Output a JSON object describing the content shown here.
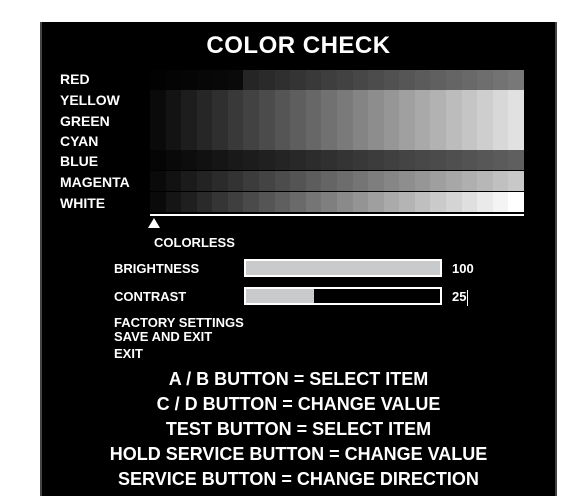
{
  "title": "COLOR CHECK",
  "color_rows": [
    {
      "label": "RED",
      "tone": "dark-top"
    },
    {
      "label": "YELLOW",
      "tone": "light"
    },
    {
      "label": "GREEN",
      "tone": "light"
    },
    {
      "label": "CYAN",
      "tone": "light"
    },
    {
      "label": "BLUE",
      "tone": "dark"
    },
    {
      "label": "MAGENTA",
      "tone": "mid"
    },
    {
      "label": "WHITE",
      "tone": "full"
    }
  ],
  "colorless_label": "COLORLESS",
  "settings": {
    "brightness": {
      "label": "BRIGHTNESS",
      "value": "100",
      "level": 1.0
    },
    "contrast": {
      "label": "CONTRAST",
      "value": "25",
      "level": 0.35
    }
  },
  "menu": {
    "factory": "FACTORY SETTINGS",
    "save_exit": "SAVE AND EXIT",
    "exit": "EXIT"
  },
  "help": [
    "A / B BUTTON = SELECT ITEM",
    "C / D BUTTON = CHANGE  VALUE",
    "TEST BUTTON = SELECT ITEM",
    "HOLD SERVICE BUTTON = CHANGE  VALUE",
    "SERVICE BUTTON = CHANGE  DIRECTION"
  ],
  "colors": {
    "background": "#000000",
    "text": "#ffffff",
    "bar_fill": "#c8cacb"
  },
  "icons": {
    "cursor": "up-triangle-icon"
  }
}
